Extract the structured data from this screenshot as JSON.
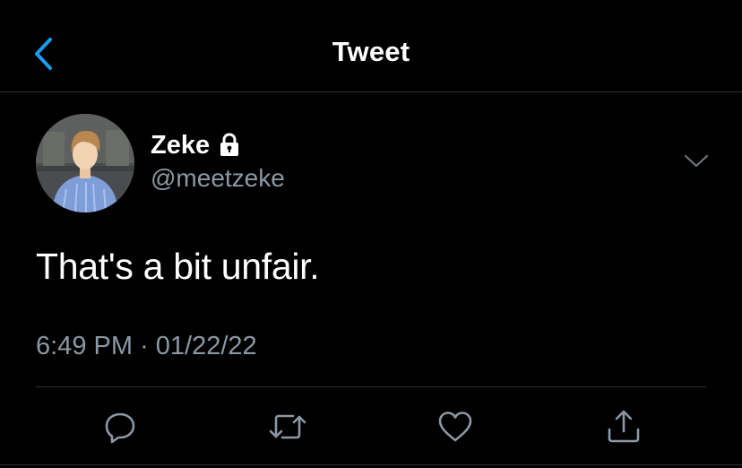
{
  "header": {
    "title": "Tweet",
    "back_icon": "chevron-left-icon"
  },
  "tweet": {
    "author": {
      "display_name": "Zeke",
      "handle": "@meetzeke",
      "protected_icon": "lock-icon",
      "avatar": "profile-photo"
    },
    "text": "That's a bit unfair.",
    "time": "6:49 PM",
    "separator": "·",
    "date": "01/22/22",
    "more_icon": "chevron-down-icon"
  },
  "actions": [
    {
      "icon": "reply-icon"
    },
    {
      "icon": "retweet-icon"
    },
    {
      "icon": "like-icon"
    },
    {
      "icon": "share-icon"
    }
  ],
  "colors": {
    "background": "#000000",
    "accent": "#1d9bf0",
    "secondary_text": "#8b98a5",
    "divider": "#2f3336"
  }
}
